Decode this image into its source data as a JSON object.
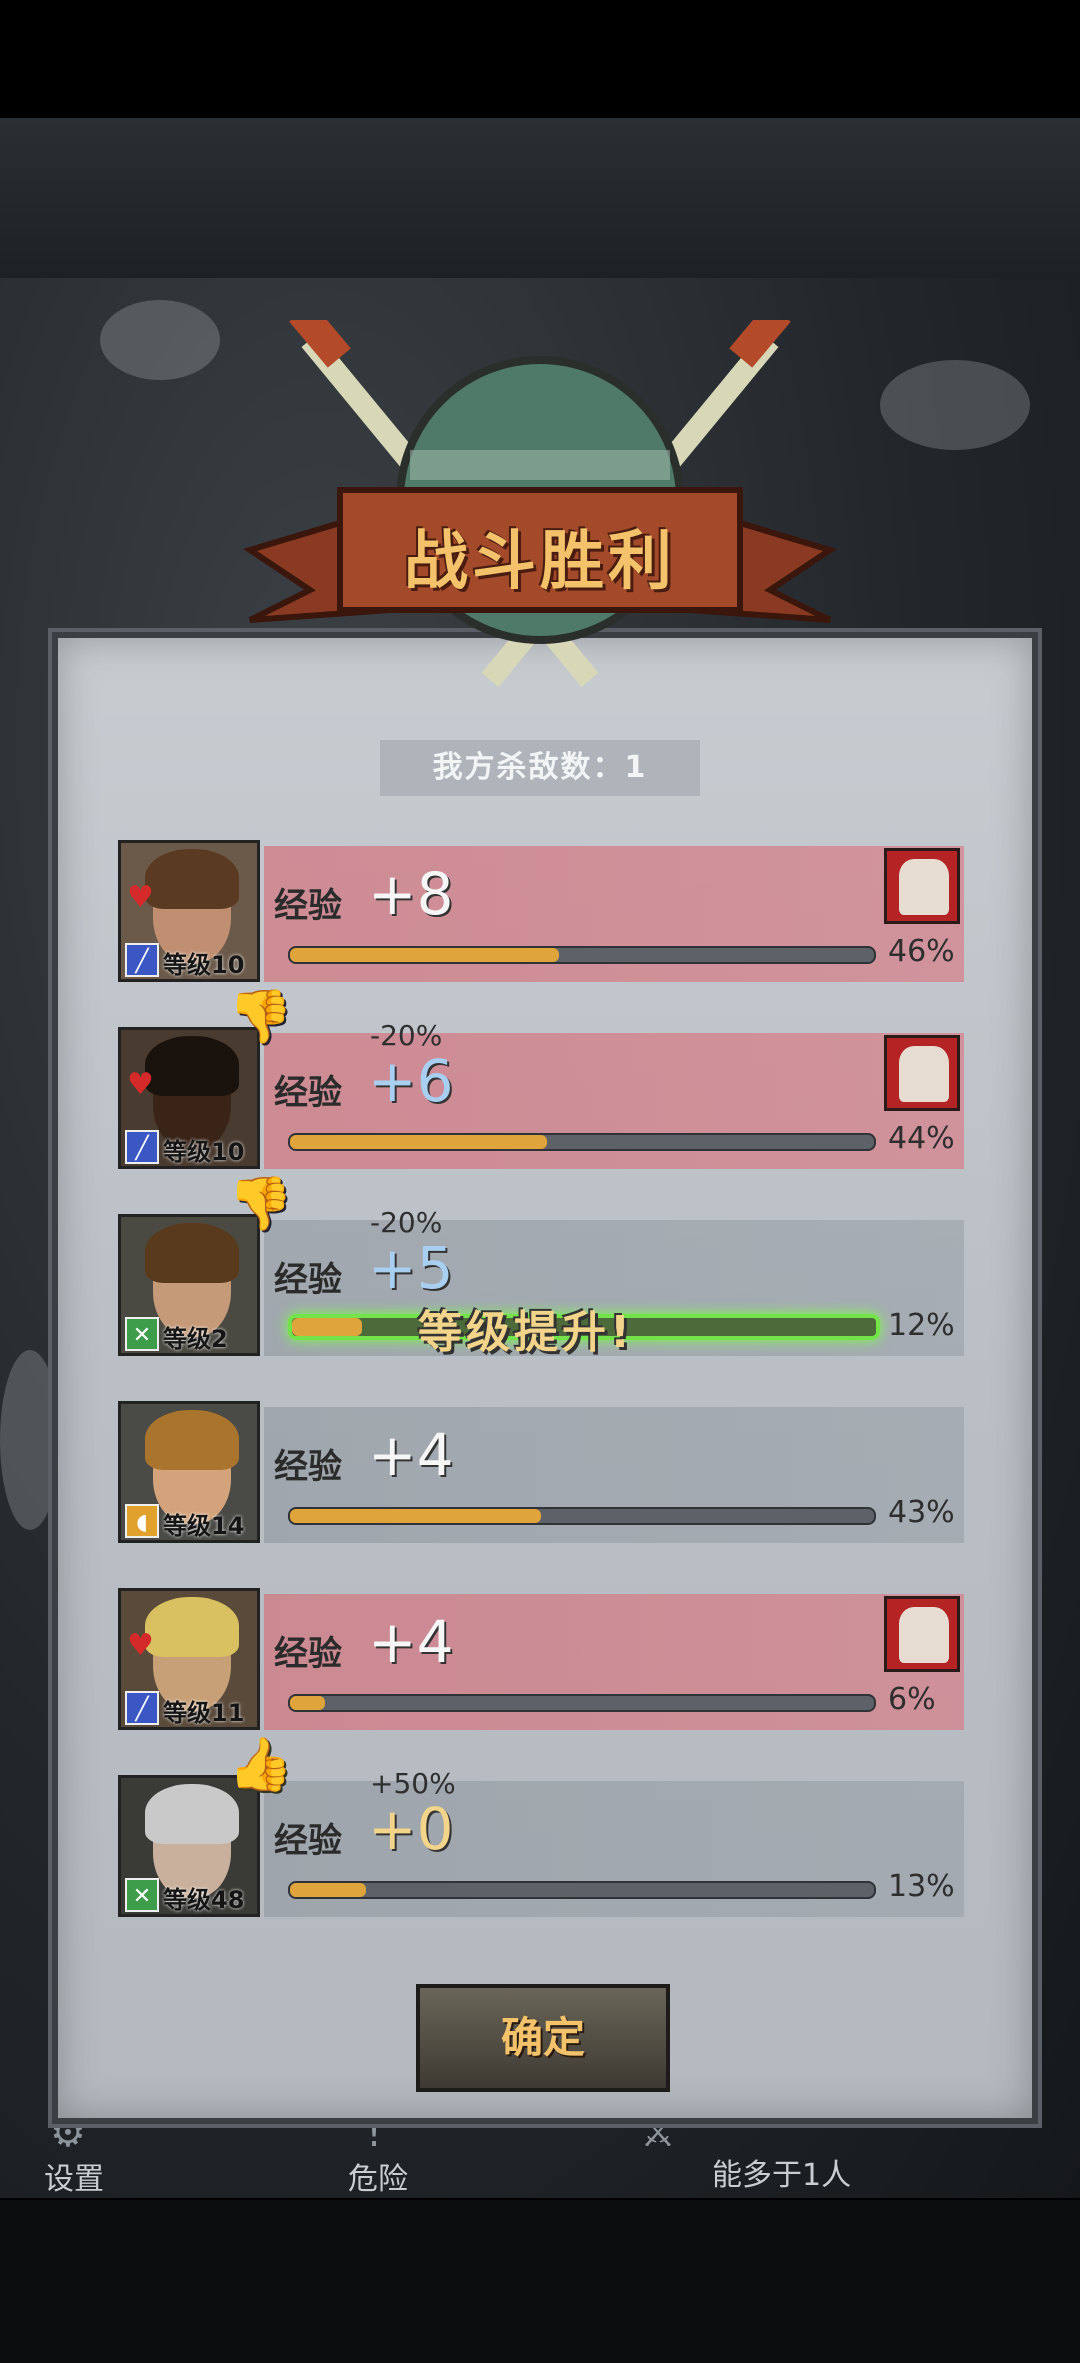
{
  "banner": {
    "title": "战斗胜利"
  },
  "summary": {
    "kill_count": "我方杀敌数：1"
  },
  "exp_label": "经验",
  "rows": [
    {
      "exp": "+8",
      "modifier": "",
      "level": "等级10",
      "percent": "46%",
      "progress": 0.46,
      "bg": "red",
      "class_icon": "sword-icon",
      "injury": true,
      "thumb": "",
      "level_up": ""
    },
    {
      "exp": "+6",
      "modifier": "-20%",
      "level": "等级10",
      "percent": "44%",
      "progress": 0.44,
      "bg": "red",
      "class_icon": "sword-icon",
      "injury": true,
      "thumb": "down",
      "level_up": ""
    },
    {
      "exp": "+5",
      "modifier": "-20%",
      "level": "等级2",
      "percent": "12%",
      "progress": 0.12,
      "bg": "grey",
      "class_icon": "crossbow-icon",
      "injury": false,
      "thumb": "down",
      "level_up": "等级提升!"
    },
    {
      "exp": "+4",
      "modifier": "",
      "level": "等级14",
      "percent": "43%",
      "progress": 0.43,
      "bg": "grey",
      "class_icon": "shield-icon",
      "injury": false,
      "thumb": "",
      "level_up": ""
    },
    {
      "exp": "+4",
      "modifier": "",
      "level": "等级11",
      "percent": "6%",
      "progress": 0.06,
      "bg": "red",
      "class_icon": "sword-icon",
      "injury": true,
      "thumb": "",
      "level_up": ""
    },
    {
      "exp": "+0",
      "modifier": "+50%",
      "level": "等级48",
      "percent": "13%",
      "progress": 0.13,
      "bg": "grey",
      "class_icon": "crossbow-icon",
      "injury": false,
      "thumb": "up",
      "level_up": ""
    }
  ],
  "confirm": {
    "label": "确定"
  },
  "nav": {
    "settings": "设置",
    "danger": "危险",
    "info_line2": "能多于1人"
  },
  "colors": {
    "exp_bar": "#e0a43c",
    "level_up_glow": "#74e24a",
    "banner_text": "#f3c26a",
    "injured_row": "#d2788c"
  }
}
